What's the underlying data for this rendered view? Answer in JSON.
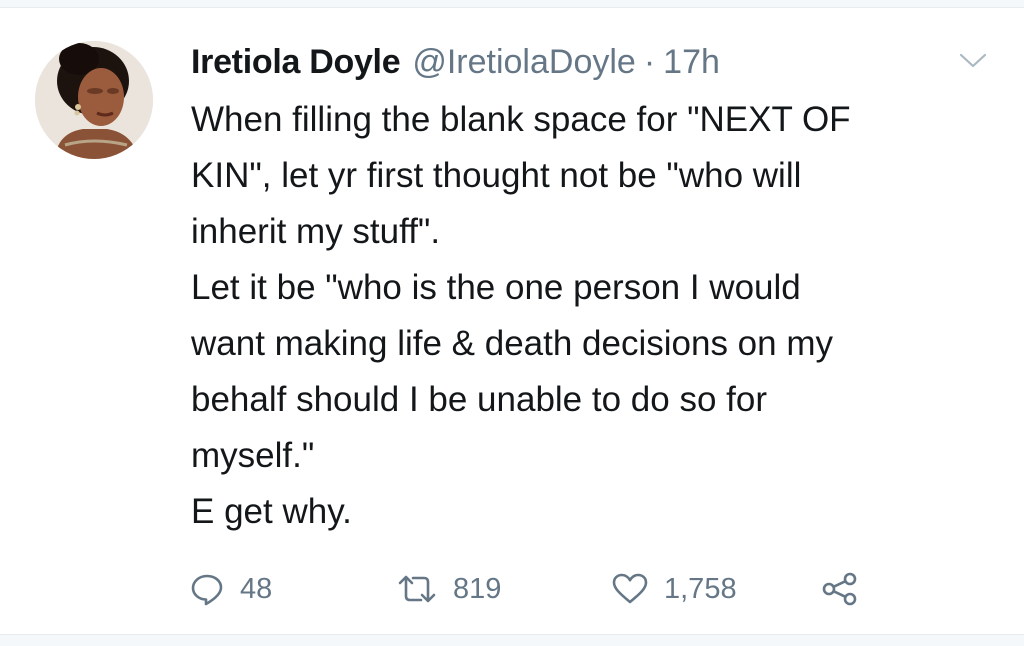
{
  "tweet": {
    "author_name": "Iretiola Doyle",
    "author_handle": "@IretiolaDoyle",
    "separator": "·",
    "time_ago": "17h",
    "lines": [
      "When filling the blank space for \"NEXT OF",
      "KIN\", let yr first thought not be \"who will",
      "inherit my stuff\".",
      "Let it be \"who is the one person I would",
      "want making life & death decisions on my",
      "behalf should I be unable to do so for",
      "myself.\"",
      "E get why."
    ]
  },
  "actions": {
    "replies": "48",
    "retweets": "819",
    "likes": "1,758"
  },
  "icons": {
    "menu": "chevron-down-icon",
    "reply": "reply-icon",
    "retweet": "retweet-icon",
    "like": "heart-icon",
    "share": "share-icon"
  },
  "colors": {
    "text": "#14171a",
    "muted": "#657786",
    "divider": "#e6ecf0"
  }
}
